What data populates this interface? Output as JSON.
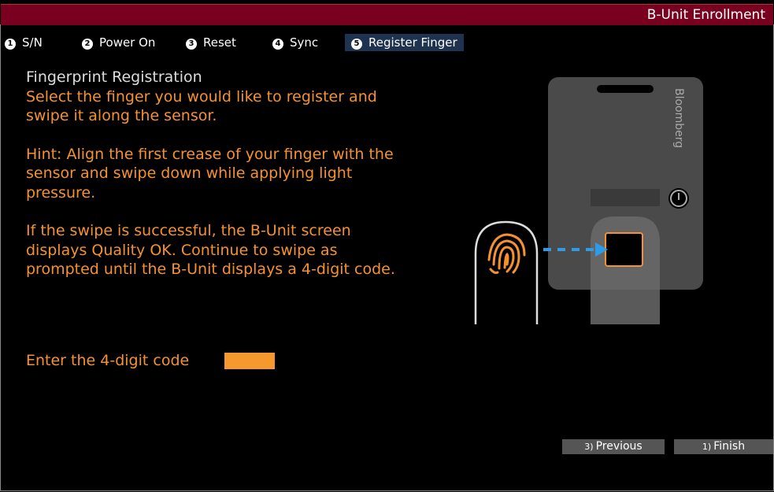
{
  "window": {
    "title": "B-Unit Enrollment"
  },
  "steps": [
    {
      "number": "1",
      "label": "S/N"
    },
    {
      "number": "2",
      "label": "Power On"
    },
    {
      "number": "3",
      "label": "Reset"
    },
    {
      "number": "4",
      "label": "Sync"
    },
    {
      "number": "5",
      "label": "Register Finger",
      "active": true
    }
  ],
  "main": {
    "heading": "Fingerprint Registration",
    "instruction": "Select the finger you would like to register and swipe it along the sensor.",
    "hint": "Hint: Align the first crease of your finger with the sensor and swipe down while applying light pressure.",
    "success_note": "If the swipe is successful, the B-Unit screen displays Quality OK. Continue to swipe as prompted until the B-Unit displays a 4-digit code.",
    "code_label": "Enter the 4-digit code",
    "code_value": ""
  },
  "device": {
    "brand": "Bloomberg"
  },
  "buttons": {
    "previous": {
      "key": "3)",
      "label": "Previous"
    },
    "finish": {
      "key": "1)",
      "label": "Finish"
    }
  },
  "colors": {
    "title_bar": "#7a0020",
    "accent": "#f5922f",
    "active_step": "#1e3350",
    "button": "#555555"
  },
  "icons": [
    "fingerprint-icon",
    "power-icon",
    "arrow-right-icon"
  ]
}
